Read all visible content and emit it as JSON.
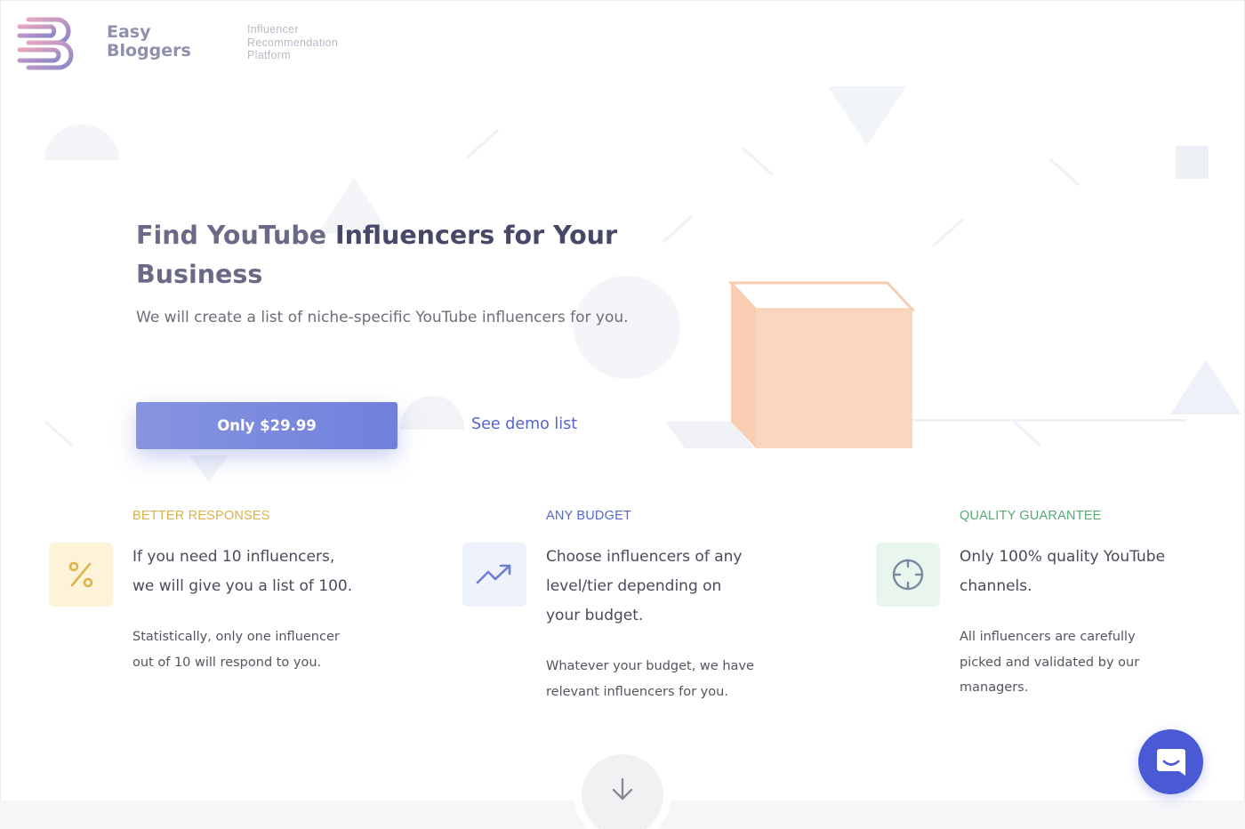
{
  "header": {
    "brand_line1": "Easy",
    "brand_line2": "Bloggers",
    "tagline_line1": "Influencer",
    "tagline_line2": "Recommendation",
    "tagline_line3": "Platform"
  },
  "hero": {
    "title_part1": "Find YouTube",
    "title_part2": "Influencers for Your",
    "title_part3": "Business",
    "subtitle": "We will create a list of niche-specific YouTube influencers for you.",
    "cta_label": "Only $29.99",
    "demo_link": "See demo list"
  },
  "features": [
    {
      "label": "BETTER RESPONSES",
      "heading_line1": "If you need 10 influencers,",
      "heading_line2": "we will give you a list of 100.",
      "body_line1": "Statistically, only one influencer",
      "body_line2": "out of 10 will respond to you.",
      "icon": "percent-icon"
    },
    {
      "label": "ANY BUDGET",
      "heading_line1": "Choose influencers of any",
      "heading_line2": "level/tier depending on",
      "heading_line3": "your budget.",
      "body_line1": "Whatever your budget, we have",
      "body_line2": "relevant influencers for you.",
      "icon": "trending-up-icon"
    },
    {
      "label": "QUALITY GUARANTEE",
      "heading_line1": "Only 100% quality YouTube",
      "heading_line2": "channels.",
      "body_line1": "All influencers are carefully",
      "body_line2": "picked and validated by our",
      "body_line3": "managers.",
      "icon": "crosshair-icon"
    }
  ],
  "colors": {
    "accent": "#7180dc",
    "link": "#5565c9",
    "label_budget": "#5565c9",
    "label_responses": "#d8b24a",
    "label_quality": "#5aa876",
    "chat": "#4a59d4",
    "box": "#fad6bf"
  }
}
